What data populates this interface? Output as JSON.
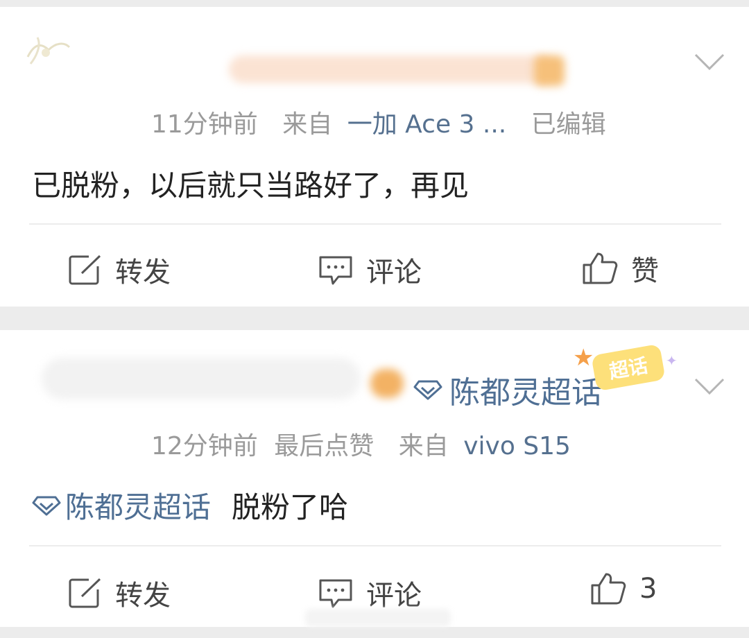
{
  "posts": [
    {
      "meta": {
        "time": "11分钟前",
        "from_label": "来自",
        "device": "一加 Ace 3 ...",
        "edited": "已编辑"
      },
      "content": {
        "text": "已脱粉，以后就只当路好了，再见"
      },
      "actions": {
        "repost": "转发",
        "comment": "评论",
        "like": "赞"
      }
    },
    {
      "topic_tag": "陈都灵超话",
      "badge": "超话",
      "meta": {
        "time": "12分钟前",
        "last_like": "最后点赞",
        "from_label": "来自",
        "device": "vivo S15"
      },
      "content": {
        "topic": "陈都灵超话",
        "text": "脱粉了哈"
      },
      "actions": {
        "repost": "转发",
        "comment": "评论",
        "like": "3"
      }
    }
  ],
  "colors": {
    "link": "#4f6f94",
    "meta": "#9a9a9a",
    "text": "#222222",
    "page_bg": "#ececec"
  },
  "icons": [
    "repost-icon",
    "comment-icon",
    "like-icon",
    "chevron-down-icon",
    "diamond-topic-icon"
  ]
}
